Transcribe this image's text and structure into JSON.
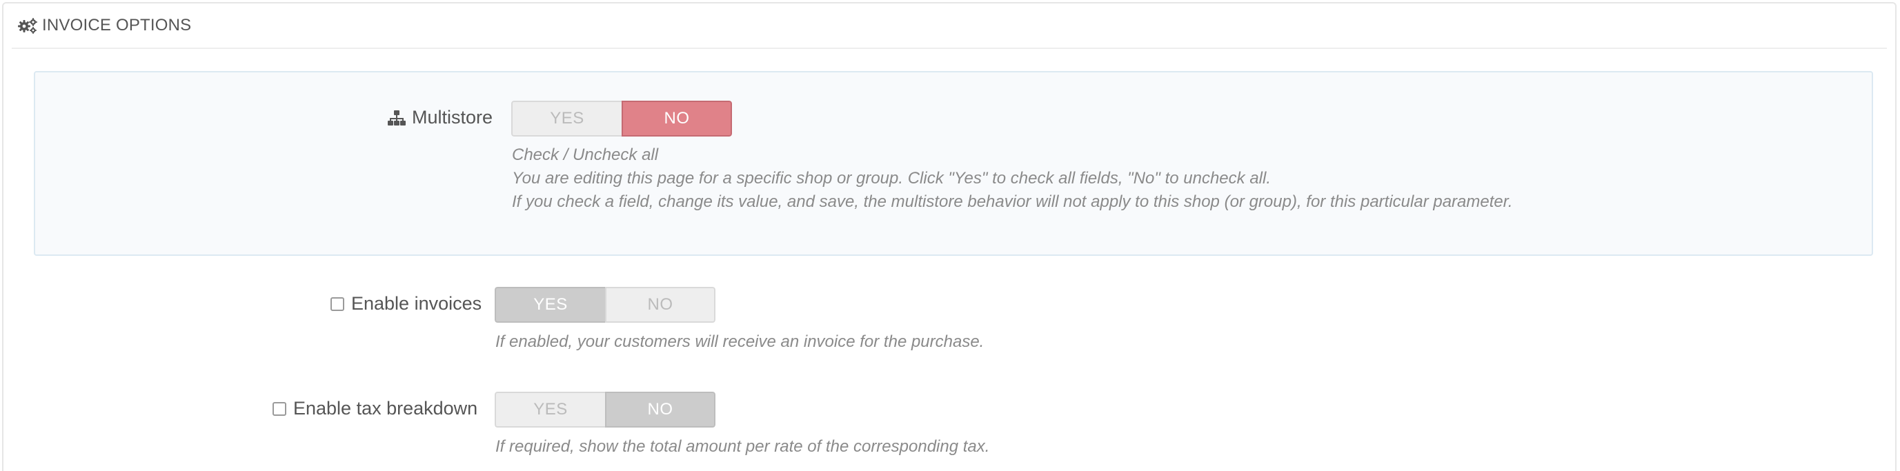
{
  "panel": {
    "title": "INVOICE OPTIONS",
    "title_icon": "cogs-icon"
  },
  "multistore": {
    "label": "Multistore",
    "icon": "sitemap-icon",
    "yes_label": "YES",
    "no_label": "NO",
    "selected": "NO",
    "help_title": "Check / Uncheck all",
    "help_line1": "You are editing this page for a specific shop or group. Click \"Yes\" to check all fields, \"No\" to uncheck all.",
    "help_line2": "If you check a field, change its value, and save, the multistore behavior will not apply to this shop (or group), for this particular parameter."
  },
  "fields": [
    {
      "label": "Enable invoices",
      "checked": false,
      "yes_label": "YES",
      "no_label": "NO",
      "selected": "YES",
      "help": "If enabled, your customers will receive an invoice for the purchase."
    },
    {
      "label": "Enable tax breakdown",
      "checked": false,
      "yes_label": "YES",
      "no_label": "NO",
      "selected": "NO",
      "help": "If required, show the total amount per rate of the corresponding tax."
    }
  ],
  "colors": {
    "active_no_multistore": "#e08289",
    "active_toggle": "#cccccc",
    "multistore_bg": "#f8fafc"
  }
}
